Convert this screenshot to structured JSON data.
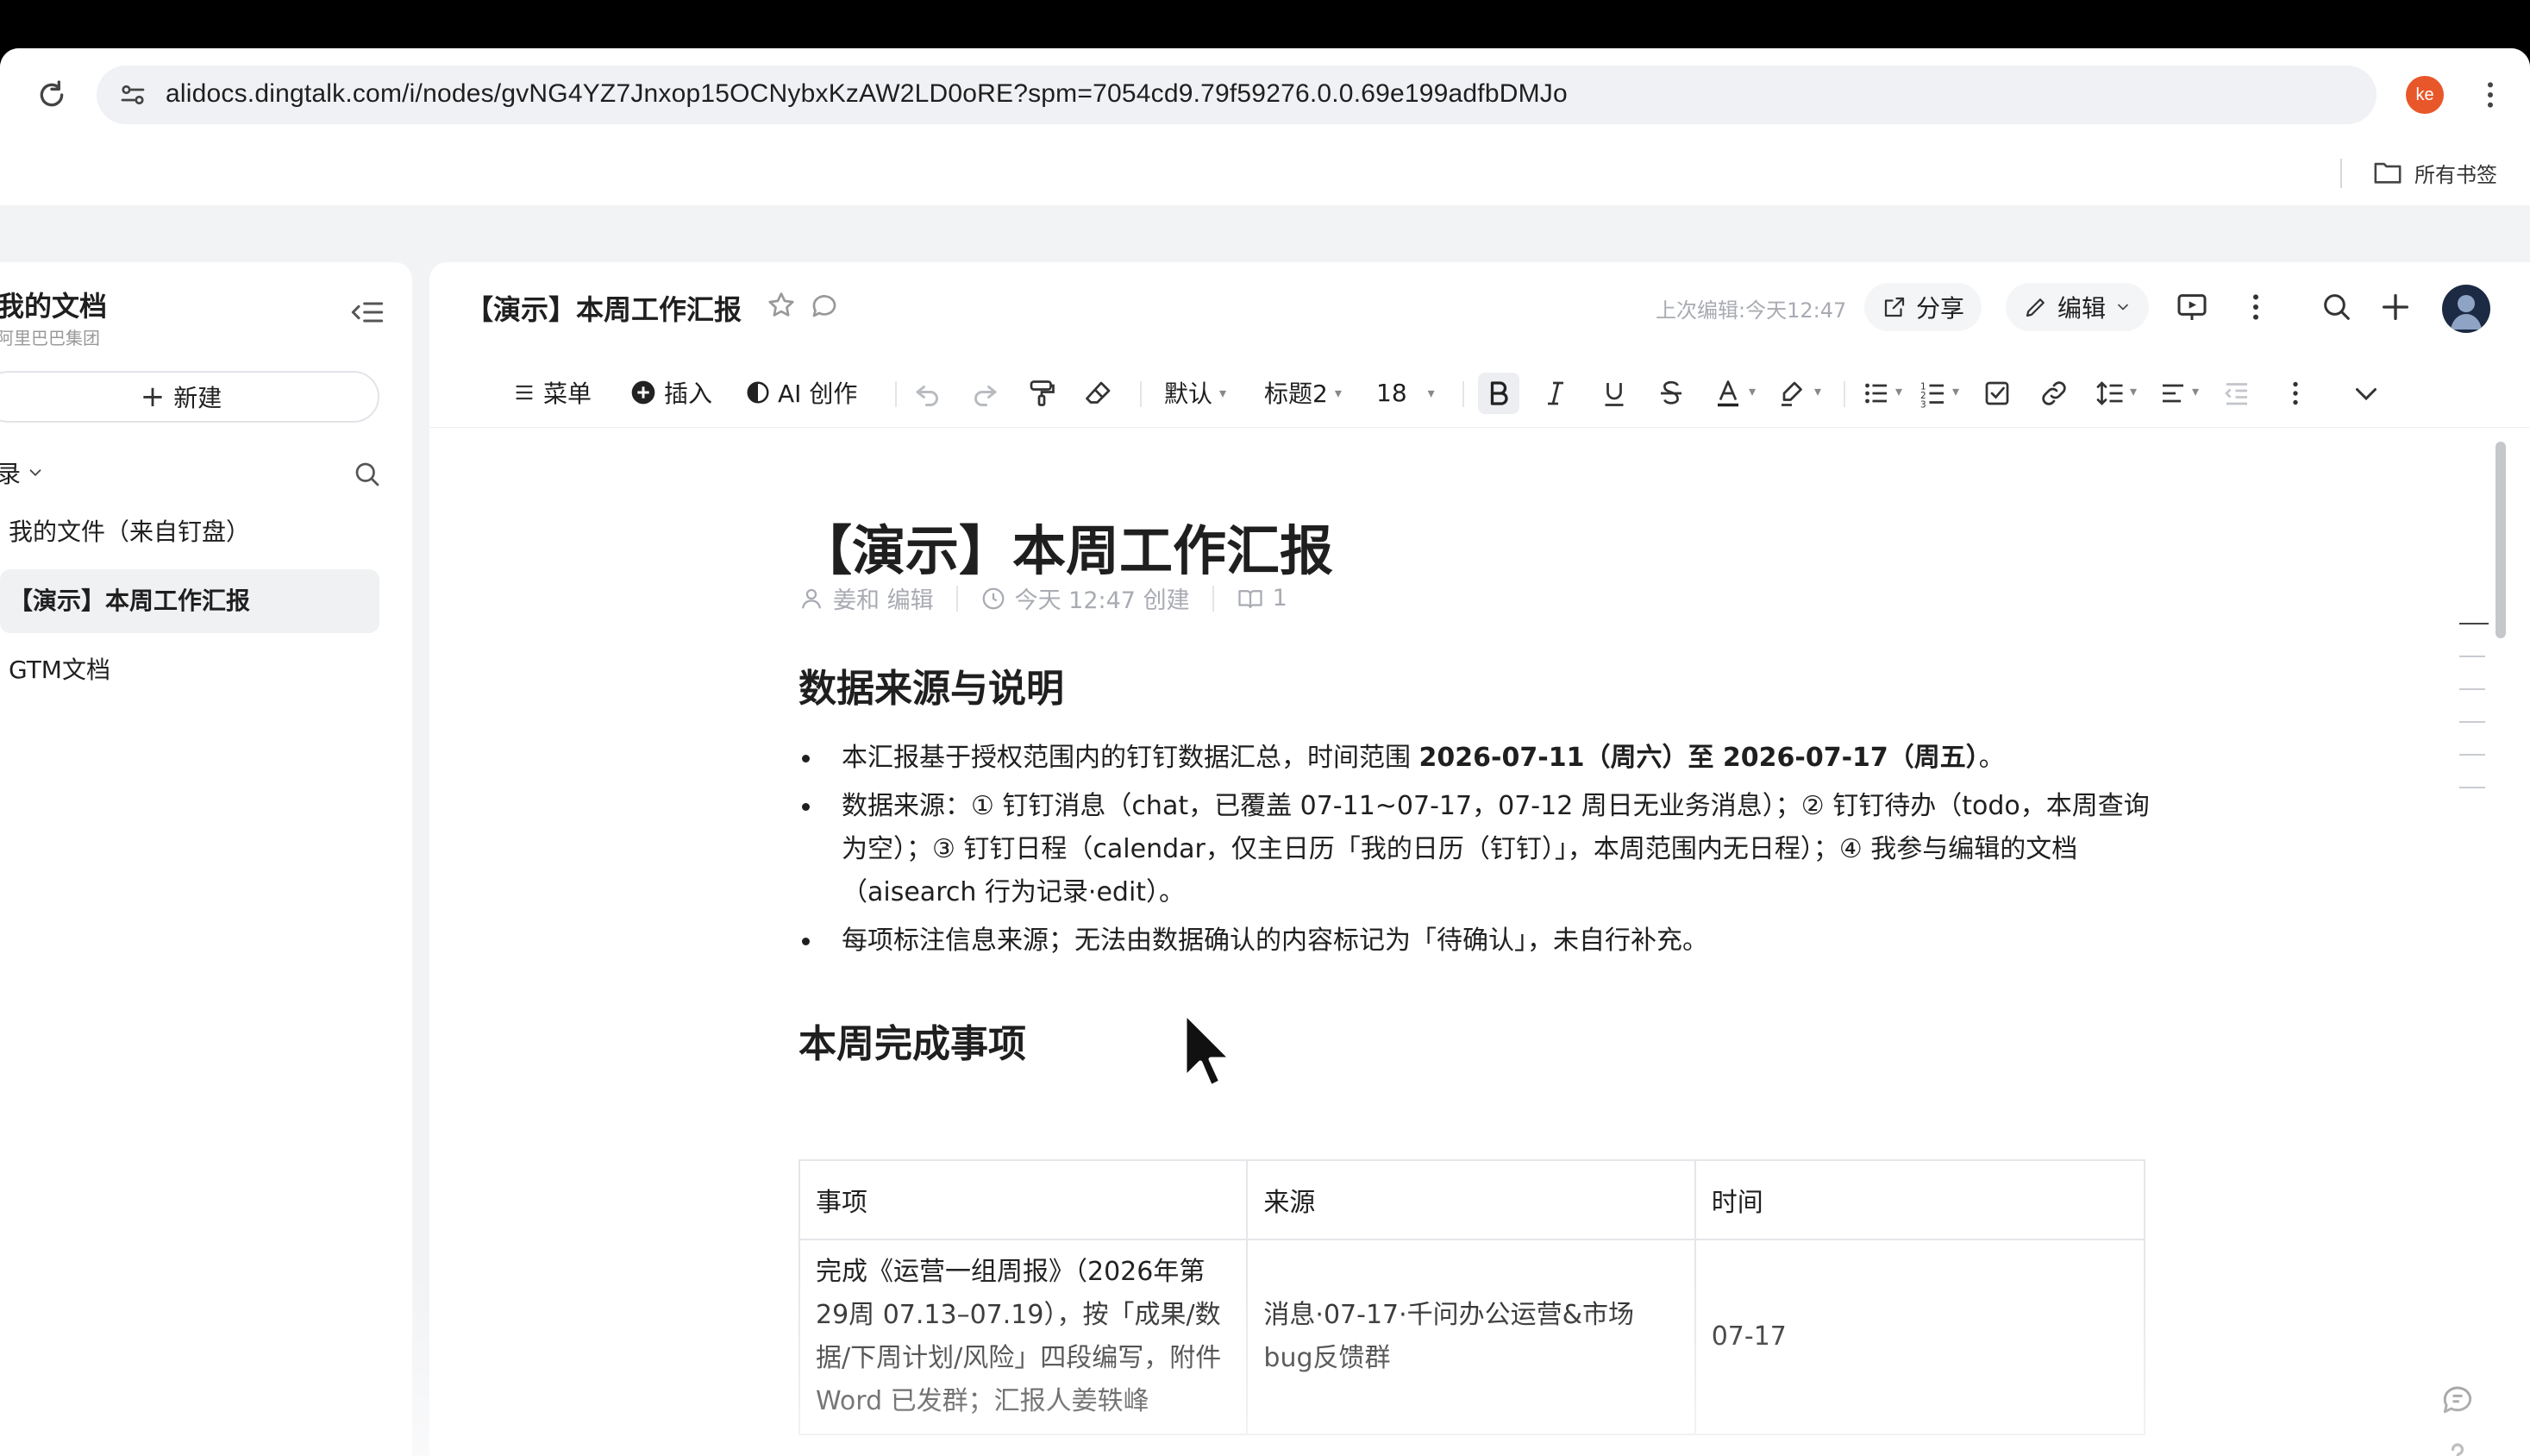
{
  "browser": {
    "url": "alidocs.dingtalk.com/i/nodes/gvNG4YZ7Jnxop15OCNybxKzAW2LD0oRE?spm=7054cd9.79f59276.0.0.69e199adfbDMJo",
    "profile_initials": "ke",
    "all_bookmarks_label": "所有书签"
  },
  "sidebar": {
    "title": "我的文档",
    "subtitle": "阿里巴巴集团",
    "new_button": "新建",
    "directory_label": "录",
    "items": [
      {
        "label": "我的文件（来自钉盘）"
      },
      {
        "label": "【演示】本周工作汇报"
      },
      {
        "label": "GTM文档"
      }
    ]
  },
  "header": {
    "doc_title": "【演示】本周工作汇报",
    "last_edit": "上次编辑:今天12:47",
    "share_label": "分享",
    "edit_label": "编辑"
  },
  "toolbar": {
    "menu_label": "菜单",
    "insert_label": "插入",
    "ai_label": "AI 创作",
    "style_default": "默认",
    "heading_select": "标题2",
    "font_size": "18"
  },
  "document": {
    "title": "【演示】本周工作汇报",
    "meta_author": "姜和 编辑",
    "meta_created": "今天 12:47 创建",
    "meta_views": "1",
    "section1_heading": "数据来源与说明",
    "bullet1_prefix": "本汇报基于授权范围内的钉钉数据汇总，时间范围 ",
    "bullet1_bold": "2026-07-11（周六）至 2026-07-17（周五）",
    "bullet1_suffix": "。",
    "bullet2": "数据来源：① 钉钉消息（chat，已覆盖 07-11~07-17，07-12 周日无业务消息）；② 钉钉待办（todo，本周查询为空）；③ 钉钉日程（calendar，仅主日历「我的日历（钉钉）」，本周范围内无日程）；④ 我参与编辑的文档（aisearch 行为记录·edit）。",
    "bullet3": "每项标注信息来源；无法由数据确认的内容标记为「待确认」，未自行补充。",
    "section2_heading": "本周完成事项",
    "table": {
      "headers": [
        "事项",
        "来源",
        "时间"
      ],
      "rows": [
        [
          "完成《运营一组周报》（2026年第29周 07.13–07.19），按「成果/数据/下周计划/风险」四段编写，附件 Word 已发群；汇报人姜轶峰",
          "消息·07-17·千问办公运营&市场bug反馈群",
          "07-17"
        ]
      ]
    }
  }
}
